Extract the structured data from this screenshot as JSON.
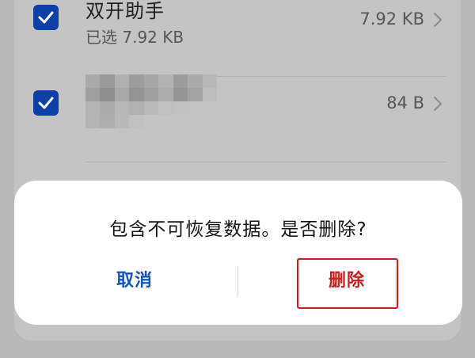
{
  "list": {
    "items": [
      {
        "title": "双开助手",
        "subtitle": "已选 7.92 KB",
        "size": "7.92 KB",
        "checked": true
      },
      {
        "title": "",
        "size": "84 B",
        "checked": true
      }
    ]
  },
  "dialog": {
    "message": "包含不可恢复数据。是否删除?",
    "cancel_label": "取消",
    "delete_label": "删除"
  },
  "colors": {
    "checkbox": "#0d3fa6",
    "cancel": "#1252c9",
    "delete": "#d11a1a",
    "highlight": "#e0151b"
  },
  "icons": {
    "checkbox": "check-icon",
    "row_arrow": "chevron-right-icon"
  }
}
